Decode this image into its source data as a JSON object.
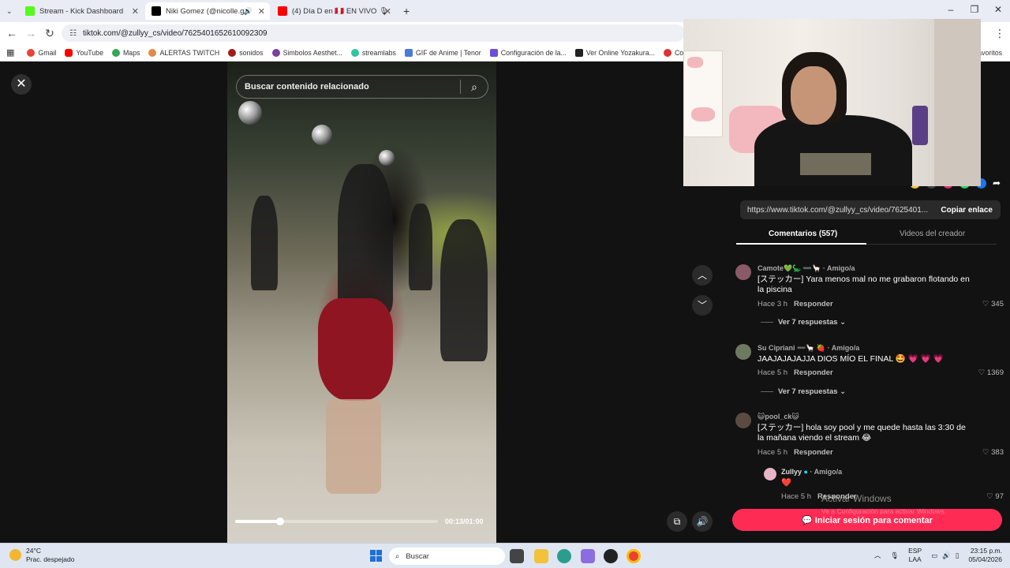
{
  "browser": {
    "tabs": [
      {
        "label": "Stream - Kick Dashboard",
        "color": "#53fc18"
      },
      {
        "label": "Niki Gomez (@nicolle.g",
        "color": "#000000"
      },
      {
        "label": "(4) Día D en 🇵🇪 EN VIVO 🎙",
        "color": "#ff0000"
      }
    ],
    "url": "tiktok.com/@zullyy_cs/video/7625401652610092309",
    "bookmarks": [
      {
        "label": "Gmail",
        "color": "#ea4335"
      },
      {
        "label": "YouTube",
        "color": "#ff0000"
      },
      {
        "label": "Maps",
        "color": "#34a853"
      },
      {
        "label": "ALERTAS TWITCH",
        "color": "#e08a4a"
      },
      {
        "label": "sonidos",
        "color": "#a11c1c"
      },
      {
        "label": "Simbolos Aesthet...",
        "color": "#7b3fa0"
      },
      {
        "label": "streamlabs",
        "color": "#31c3a2"
      },
      {
        "label": "GIF de Anime | Tenor",
        "color": "#4a7ad8"
      },
      {
        "label": "Configuración de la...",
        "color": "#6b4fd8"
      },
      {
        "label": "Ver Online Yozakura...",
        "color": "#222222"
      },
      {
        "label": "Convertir Word",
        "color": "#d33"
      }
    ],
    "favorites_label": "avoritos"
  },
  "video": {
    "search_placeholder": "Buscar contenido relacionado",
    "time": "00:13/01:00",
    "progress": 0.22
  },
  "panel": {
    "link_url": "https://www.tiktok.com/@zullyy_cs/video/7625401...",
    "copy_label": "Copiar enlace",
    "tab_comments": "Comentarios (557)",
    "tab_creator": "Videos del creador",
    "comments": [
      {
        "user": "Camote💚🦕 ➖🦙 · Amigo/a",
        "text": "[ステッカー] Yara menos mal no me grabaron flotando en la piscina",
        "time": "Hace 3 h",
        "reply": "Responder",
        "likes": "345",
        "more": "Ver 7 respuestas",
        "avatar_color": "#8a5a66"
      },
      {
        "user": "Su Cipriani ➖🦙 🍓 · Amigo/a",
        "text": "JAAJAJAJAJJA DIOS MÍO EL FINAL 🤩 💗 💗 💗",
        "time": "Hace 5 h",
        "reply": "Responder",
        "likes": "1369",
        "more": "Ver 7 respuestas",
        "avatar_color": "#6e7a60"
      },
      {
        "user": "😺pool_ck😺",
        "text": "[ステッカー] hola soy pool y me quede hasta las 3:30 de la mañana viendo el stream 😂",
        "time": "Hace 5 h",
        "reply": "Responder",
        "likes": "383",
        "avatar_color": "#5a4a40"
      }
    ],
    "reply": {
      "user": "Zullyy",
      "badge": "· Amigo/a",
      "text": "❤️",
      "time": "Hace 5 h",
      "reply": "Responder",
      "likes": "97",
      "avatar_color": "#e7b5c4"
    },
    "login_label": "💬 Iniciar sesión para comentar"
  },
  "windows": {
    "activate_title": "Activar Windows",
    "activate_sub": "Ve a Configuración para activar Windows.",
    "weather_temp": "24°C",
    "weather_desc": "Prac. despejado",
    "search_label": "Buscar",
    "lang_1": "ESP",
    "lang_2": "LAA",
    "time": "23:15 p.m.",
    "date": "05/04/2026"
  }
}
